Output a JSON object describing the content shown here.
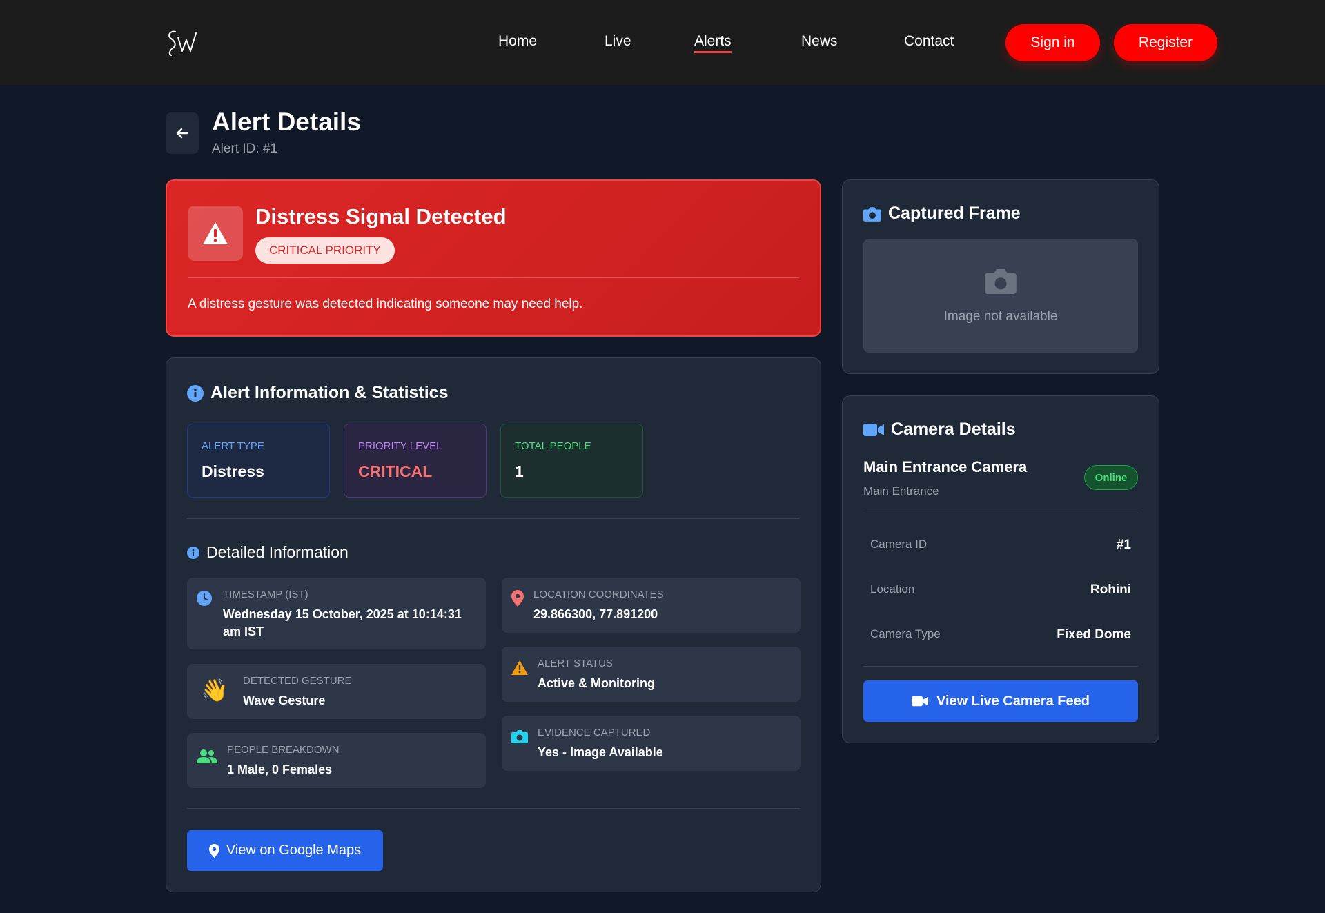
{
  "nav": {
    "logo_text": "Sw",
    "links": [
      "Home",
      "Live",
      "Alerts",
      "News",
      "Contact"
    ],
    "active": "Alerts",
    "signin_label": "Sign in",
    "register_label": "Register"
  },
  "header": {
    "title": "Alert Details",
    "subtitle": "Alert ID: #1"
  },
  "banner": {
    "title": "Distress Signal Detected",
    "badge": "CRITICAL PRIORITY",
    "description": "A distress gesture was detected indicating someone may need help."
  },
  "info": {
    "title": "Alert Information & Statistics",
    "stats": [
      {
        "label": "ALERT TYPE",
        "value": "Distress"
      },
      {
        "label": "PRIORITY LEVEL",
        "value": "CRITICAL"
      },
      {
        "label": "TOTAL PEOPLE",
        "value": "1"
      }
    ],
    "detailed_title": "Detailed Information",
    "details": {
      "timestamp": {
        "label": "TIMESTAMP (IST)",
        "value": "Wednesday 15 October, 2025 at 10:14:31 am IST"
      },
      "location": {
        "label": "LOCATION COORDINATES",
        "value": "29.866300, 77.891200"
      },
      "status": {
        "label": "ALERT STATUS",
        "value": "Active & Monitoring"
      },
      "gesture": {
        "label": "DETECTED GESTURE",
        "value": "Wave Gesture",
        "emoji": "👋"
      },
      "evidence": {
        "label": "EVIDENCE CAPTURED",
        "value": "Yes - Image Available"
      },
      "people": {
        "label": "PEOPLE BREAKDOWN",
        "value": "1 Male, 0 Females"
      }
    },
    "maps_label": "View on Google Maps"
  },
  "frame": {
    "title": "Captured Frame",
    "placeholder": "Image not available"
  },
  "camera": {
    "title": "Camera Details",
    "name": "Main Entrance Camera",
    "location": "Main Entrance",
    "status": "Online",
    "rows": [
      {
        "key": "Camera ID",
        "value": "#1"
      },
      {
        "key": "Location",
        "value": "Rohini"
      },
      {
        "key": "Camera Type",
        "value": "Fixed Dome"
      }
    ],
    "live_label": "View Live Camera Feed"
  },
  "colors": {
    "accent_red": "#ff0000",
    "critical": "#dc2626",
    "primary_blue": "#2563eb",
    "online_green": "#4ade80",
    "background": "#111827",
    "card": "#1f2937"
  },
  "icons": {
    "back": "arrow-left-icon",
    "warning": "warning-triangle-icon",
    "info": "info-circle-icon",
    "clock": "clock-icon",
    "pin": "map-pin-icon",
    "alert": "alert-triangle-icon",
    "gesture": "wave-hand-icon",
    "camera": "camera-icon",
    "people": "people-icon",
    "video": "video-camera-icon"
  }
}
